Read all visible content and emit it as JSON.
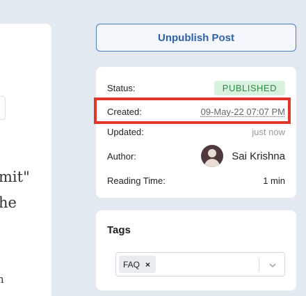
{
  "editor": {
    "line1": "mit\"",
    "line2": "he",
    "line3": "n"
  },
  "actions": {
    "unpublish_label": "Unpublish Post"
  },
  "meta": {
    "status_label": "Status:",
    "status_value": "PUBLISHED",
    "created_label": "Created:",
    "created_value": "09-May-22 07:07 PM",
    "updated_label": "Updated:",
    "updated_value": "just now",
    "author_label": "Author:",
    "author_name": "Sai Krishna",
    "reading_label": "Reading Time:",
    "reading_value": "1 min"
  },
  "tags": {
    "title": "Tags",
    "items": [
      "FAQ"
    ],
    "remove_glyph": "×"
  },
  "colors": {
    "accent": "#2f62a8",
    "published_bg": "#d8f2dd",
    "published_text": "#2e8a47",
    "highlight": "#e0352b"
  },
  "icons": {
    "avatar": "user-avatar-icon",
    "dropdown": "chevron-down-icon",
    "remove": "close-icon"
  }
}
